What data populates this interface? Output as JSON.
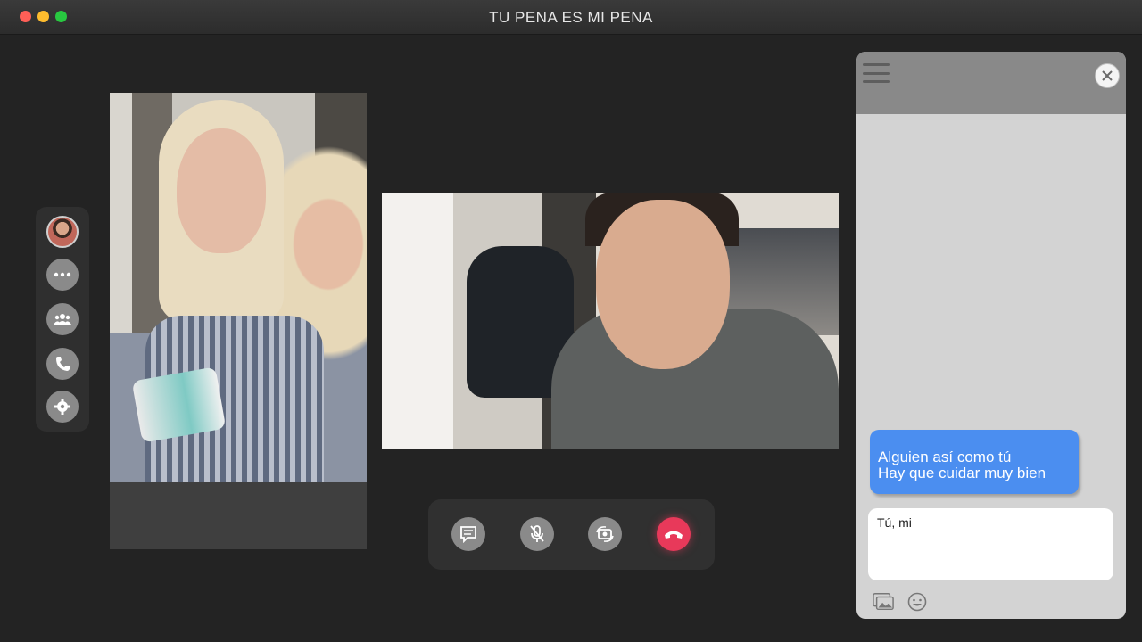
{
  "window": {
    "title": "TU PENA ES MI PENA"
  },
  "sidebar": {
    "items": [
      {
        "name": "contact-avatar",
        "icon": "avatar"
      },
      {
        "name": "more",
        "icon": "ellipsis-icon"
      },
      {
        "name": "contacts",
        "icon": "group-icon"
      },
      {
        "name": "call",
        "icon": "phone-icon"
      },
      {
        "name": "settings",
        "icon": "gear-icon"
      }
    ]
  },
  "call_controls": {
    "items": [
      {
        "name": "chat",
        "icon": "chat-icon"
      },
      {
        "name": "mute",
        "icon": "mic-off-icon"
      },
      {
        "name": "switch-camera",
        "icon": "camera-switch-icon"
      },
      {
        "name": "end-call",
        "icon": "hang-up-icon",
        "color": "#e8395a"
      }
    ]
  },
  "chat": {
    "messages": [
      {
        "lines": [
          "Alguien así como tú",
          "Hay que cuidar muy bien"
        ],
        "color": "#4b8ef0"
      }
    ],
    "input_value": "Tú, mi"
  },
  "colors": {
    "accent": "#4b8ef0",
    "end_call": "#e8395a"
  }
}
